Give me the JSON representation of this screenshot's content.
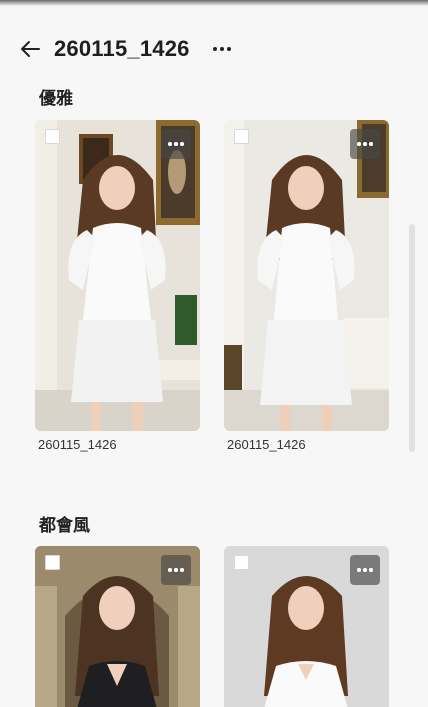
{
  "header": {
    "title": "260115_1426"
  },
  "sections": [
    {
      "title": "優雅",
      "items": [
        {
          "caption": "260115_1426"
        },
        {
          "caption": "260115_1426"
        }
      ]
    },
    {
      "title": "都會風",
      "items": [
        {
          "caption": ""
        },
        {
          "caption": ""
        }
      ]
    }
  ],
  "colors": {
    "background": "#f7f7f8",
    "text": "#1f1f1f",
    "menu_button": "#464646"
  },
  "icons": [
    "arrow-left-icon",
    "more-horizontal-icon",
    "checkbox-icon"
  ]
}
